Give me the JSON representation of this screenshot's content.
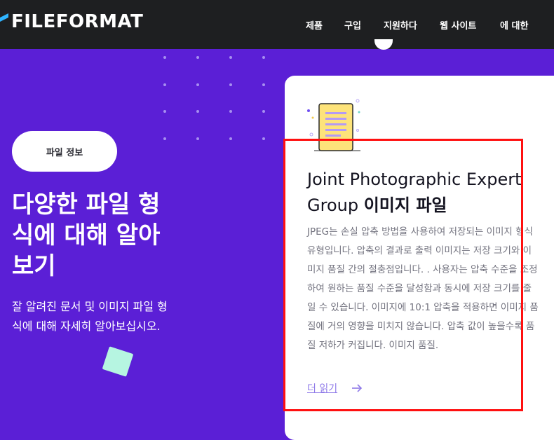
{
  "header": {
    "logo_text": "FILEFORMAT",
    "nav": [
      "제품",
      "구입",
      "지원하다",
      "웹 사이트",
      "에 대한"
    ]
  },
  "hero": {
    "badge": "파일 정보",
    "title": "다양한 파일 형식에 대해 알아보기",
    "subtitle": "잘 알려진 문서 및 이미지 파일 형식에 대해 자세히 알아보십시오."
  },
  "card": {
    "icon": "document-icon",
    "title_regular": "Joint Photographic Expert Group",
    "title_bold": "이미지 파일",
    "description": "JPEG는 손실 압축 방법을 사용하여 저장되는 이미지 형식 유형입니다. 압축의 결과로 출력 이미지는 저장 크기와 이미지 품질 간의 절충점입니다. . 사용자는 압축 수준을 조정하여 원하는 품질 수준을 달성함과 동시에 저장 크기를 줄일 수 있습니다. 이미지에 10:1 압축을 적용하면 이미지 품질에 거의 영향을 미치지 않습니다. 압축 값이 높을수록 품질 저하가 커집니다. 이미지 품질.",
    "read_more": "더 읽기"
  },
  "colors": {
    "hero_bg": "#5b1fd6",
    "nav_bg": "#1e1f21",
    "accent_link": "#8f7ae8",
    "highlight": "#ff1010"
  }
}
